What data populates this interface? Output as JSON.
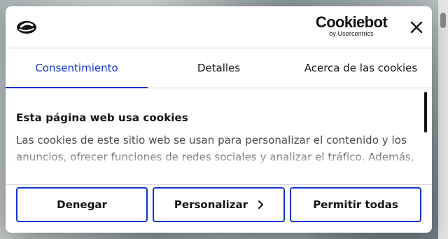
{
  "dialog": {
    "brand": {
      "name": "Cookiebot",
      "sub": "by Usercentrics"
    },
    "close_icon": "close-icon",
    "tabs": [
      {
        "label": "Consentimiento",
        "active": true
      },
      {
        "label": "Detalles",
        "active": false
      },
      {
        "label": "Acerca de las cookies",
        "active": false
      }
    ],
    "content": {
      "title": "Esta página web usa cookies",
      "body": "Las cookies de este sitio web se usan para personalizar el contenido y los anuncios, ofrecer funciones de redes sociales y analizar el tráfico. Además,"
    },
    "buttons": {
      "deny": "Denegar",
      "customize": "Personalizar",
      "allow_all": "Permitir todas"
    }
  },
  "colors": {
    "accent": "#1032cf",
    "text": "#141414",
    "body_text": "#4b4b4b",
    "divider": "#d6d6d6"
  }
}
